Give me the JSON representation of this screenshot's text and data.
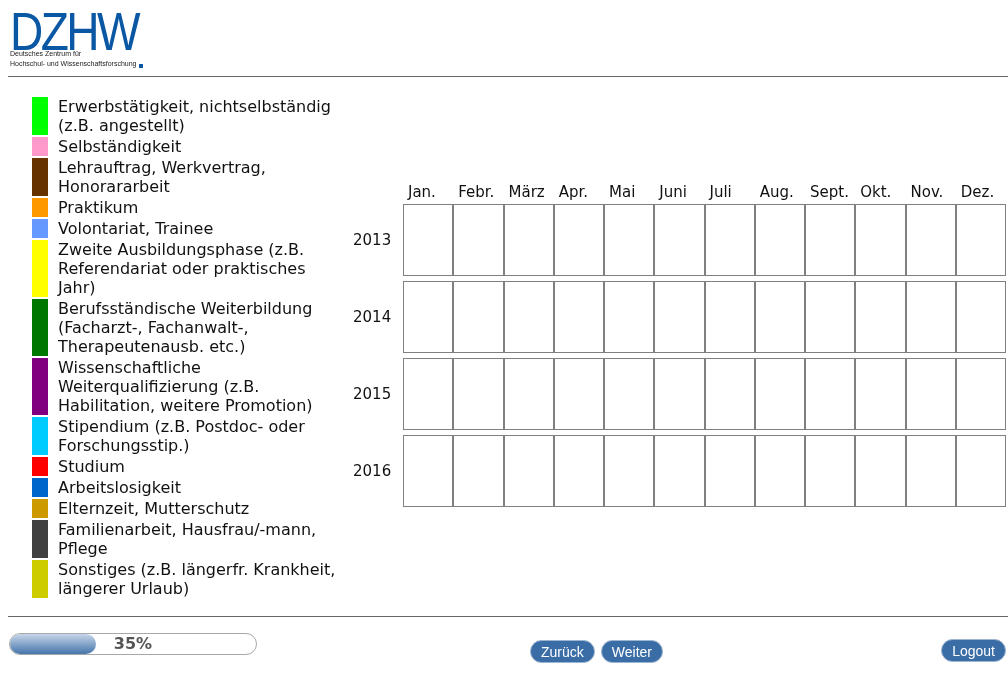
{
  "logo": {
    "wordmark": "DZHW",
    "tagline_lines": [
      "Deutsches Zentrum für",
      "Hochschul- und Wissenschaftsforschung"
    ]
  },
  "legend": [
    {
      "label": "Erwerbstätigkeit, nichtselbständig (z.B. angestellt)",
      "color": "#00ff00"
    },
    {
      "label": "Selbständigkeit",
      "color": "#ff99cc"
    },
    {
      "label": "Lehrauftrag, Werkvertrag, Honorararbeit",
      "color": "#663300"
    },
    {
      "label": "Praktikum",
      "color": "#ff9900"
    },
    {
      "label": "Volontariat, Trainee",
      "color": "#6699ff"
    },
    {
      "label": "Zweite Ausbildungsphase (z.B. Referendariat oder praktisches Jahr)",
      "color": "#ffff00"
    },
    {
      "label": "Berufsständische Weiterbildung (Facharzt-, Fachanwalt-, Therapeutenausb. etc.)",
      "color": "#007700"
    },
    {
      "label": "Wissenschaftliche Weiterqualifizierung (z.B. Habilitation, weitere Promotion)",
      "color": "#800080"
    },
    {
      "label": "Stipendium (z.B. Postdoc- oder Forschungsstip.)",
      "color": "#00ccff"
    },
    {
      "label": "Studium",
      "color": "#ff0000"
    },
    {
      "label": "Arbeitslosigkeit",
      "color": "#0066cc"
    },
    {
      "label": "Elternzeit, Mutterschutz",
      "color": "#cc9900"
    },
    {
      "label": "Familienarbeit, Hausfrau/-mann, Pflege",
      "color": "#404040"
    },
    {
      "label": "Sonstiges (z.B. längerfr. Krankheit, längerer Urlaub)",
      "color": "#cccc00"
    }
  ],
  "calendar": {
    "months": [
      "Jan.",
      "Febr.",
      "März",
      "Apr.",
      "Mai",
      "Juni",
      "Juli",
      "Aug.",
      "Sept.",
      "Okt.",
      "Nov.",
      "Dez."
    ],
    "years": [
      "2013",
      "2014",
      "2015",
      "2016"
    ]
  },
  "progress": {
    "level": 0.35,
    "reading": "35%"
  },
  "navigation": {
    "buttons": [
      "Zurück",
      "Weiter"
    ]
  },
  "logout": "Logout"
}
